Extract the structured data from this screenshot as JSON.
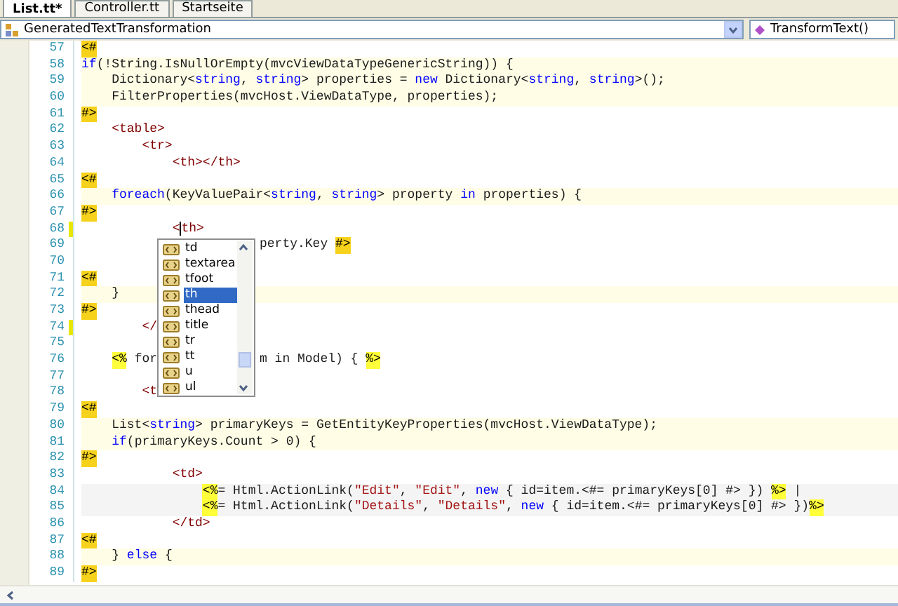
{
  "tabs": [
    {
      "label": "List.tt*",
      "selected": true
    },
    {
      "label": "Controller.tt",
      "selected": false
    },
    {
      "label": "Startseite",
      "selected": false
    }
  ],
  "navigation_bar": {
    "type_combo": "GeneratedTextTransformation",
    "member_combo": "TransformText()"
  },
  "editor": {
    "lines": [
      {
        "number": "57",
        "kind": "text",
        "changed": false,
        "segments": [
          {
            "kind": "marker",
            "text": "<#"
          }
        ]
      },
      {
        "number": "58",
        "kind": "code",
        "changed": false,
        "segments": [
          {
            "kind": "keyword",
            "text": "if"
          },
          {
            "kind": "plain",
            "text": "(!String.IsNullOrEmpty(mvcViewDataTypeGenericString)) {"
          }
        ]
      },
      {
        "number": "59",
        "kind": "code",
        "changed": false,
        "segments": [
          {
            "kind": "plain",
            "text": "    Dictionary<"
          },
          {
            "kind": "keyword",
            "text": "string"
          },
          {
            "kind": "plain",
            "text": ", "
          },
          {
            "kind": "keyword",
            "text": "string"
          },
          {
            "kind": "plain",
            "text": "> properties = "
          },
          {
            "kind": "keyword",
            "text": "new"
          },
          {
            "kind": "plain",
            "text": " Dictionary<"
          },
          {
            "kind": "keyword",
            "text": "string"
          },
          {
            "kind": "plain",
            "text": ", "
          },
          {
            "kind": "keyword",
            "text": "string"
          },
          {
            "kind": "plain",
            "text": ">();"
          }
        ]
      },
      {
        "number": "60",
        "kind": "code",
        "changed": false,
        "segments": [
          {
            "kind": "plain",
            "text": "    FilterProperties(mvcHost.ViewDataType, properties);"
          }
        ]
      },
      {
        "number": "61",
        "kind": "text",
        "changed": false,
        "segments": [
          {
            "kind": "marker",
            "text": "#>"
          }
        ]
      },
      {
        "number": "62",
        "kind": "text",
        "changed": false,
        "segments": [
          {
            "kind": "tag",
            "text": "    <table>"
          }
        ]
      },
      {
        "number": "63",
        "kind": "text",
        "changed": false,
        "segments": [
          {
            "kind": "tag",
            "text": "        <tr>"
          }
        ]
      },
      {
        "number": "64",
        "kind": "text",
        "changed": false,
        "segments": [
          {
            "kind": "tag",
            "text": "            <th></th>"
          }
        ]
      },
      {
        "number": "65",
        "kind": "text",
        "changed": false,
        "segments": [
          {
            "kind": "marker",
            "text": "<#"
          }
        ]
      },
      {
        "number": "66",
        "kind": "code",
        "changed": false,
        "segments": [
          {
            "kind": "keyword",
            "text": "    foreach"
          },
          {
            "kind": "plain",
            "text": "(KeyValuePair<"
          },
          {
            "kind": "keyword",
            "text": "string"
          },
          {
            "kind": "plain",
            "text": ", "
          },
          {
            "kind": "keyword",
            "text": "string"
          },
          {
            "kind": "plain",
            "text": "> property "
          },
          {
            "kind": "keyword",
            "text": "in"
          },
          {
            "kind": "plain",
            "text": " properties) {"
          }
        ]
      },
      {
        "number": "67",
        "kind": "text",
        "changed": false,
        "segments": [
          {
            "kind": "marker",
            "text": "#>"
          }
        ]
      },
      {
        "number": "68",
        "kind": "text",
        "changed": true,
        "cursor": true,
        "segments": [
          {
            "kind": "tag",
            "text": "            <"
          },
          {
            "kind": "tag",
            "text": "th>"
          }
        ]
      },
      {
        "number": "69",
        "kind": "text",
        "changed": false,
        "tail": [
          {
            "kind": "plain",
            "text": "perty.Key "
          },
          {
            "kind": "marker",
            "text": "#>"
          }
        ]
      },
      {
        "number": "70",
        "kind": "text",
        "changed": false
      },
      {
        "number": "71",
        "kind": "text",
        "changed": false,
        "segments": [
          {
            "kind": "marker",
            "text": "<#"
          }
        ]
      },
      {
        "number": "72",
        "kind": "code",
        "changed": false,
        "segments": [
          {
            "kind": "plain",
            "text": "    }"
          }
        ]
      },
      {
        "number": "73",
        "kind": "text",
        "changed": false,
        "segments": [
          {
            "kind": "marker",
            "text": "#>"
          }
        ]
      },
      {
        "number": "74",
        "kind": "text",
        "changed": true,
        "segments": [
          {
            "kind": "tag",
            "text": "        </"
          }
        ]
      },
      {
        "number": "75",
        "kind": "text",
        "changed": false
      },
      {
        "number": "76",
        "kind": "text",
        "changed": false,
        "segments": [
          {
            "kind": "asp",
            "text": "    <%"
          },
          {
            "kind": "plain",
            "text": " for"
          }
        ],
        "tail": [
          {
            "kind": "plain",
            "text": "m in Model) { "
          },
          {
            "kind": "asp",
            "text": "%>"
          }
        ]
      },
      {
        "number": "77",
        "kind": "text",
        "changed": false
      },
      {
        "number": "78",
        "kind": "text",
        "changed": false,
        "segments": [
          {
            "kind": "tag",
            "text": "        <t"
          }
        ]
      },
      {
        "number": "79",
        "kind": "text",
        "changed": false,
        "segments": [
          {
            "kind": "marker",
            "text": "<#"
          }
        ]
      },
      {
        "number": "80",
        "kind": "code",
        "changed": false,
        "segments": [
          {
            "kind": "plain",
            "text": "    List<"
          },
          {
            "kind": "keyword",
            "text": "string"
          },
          {
            "kind": "plain",
            "text": "> primaryKeys = GetEntityKeyProperties(mvcHost.ViewDataType);"
          }
        ]
      },
      {
        "number": "81",
        "kind": "code",
        "changed": false,
        "segments": [
          {
            "kind": "keyword",
            "text": "    if"
          },
          {
            "kind": "plain",
            "text": "(primaryKeys.Count > 0) {"
          }
        ]
      },
      {
        "number": "82",
        "kind": "text",
        "changed": false,
        "segments": [
          {
            "kind": "marker",
            "text": "#>"
          }
        ]
      },
      {
        "number": "83",
        "kind": "text",
        "changed": false,
        "segments": [
          {
            "kind": "tag",
            "text": "            <td>"
          }
        ]
      },
      {
        "number": "84",
        "kind": "server",
        "changed": false,
        "segments": [
          {
            "kind": "asp",
            "text": "                <%"
          },
          {
            "kind": "plain",
            "text": "= Html.ActionLink("
          },
          {
            "kind": "string",
            "text": "\"Edit\""
          },
          {
            "kind": "plain",
            "text": ", "
          },
          {
            "kind": "string",
            "text": "\"Edit\""
          },
          {
            "kind": "plain",
            "text": ", "
          },
          {
            "kind": "keyword",
            "text": "new"
          },
          {
            "kind": "plain",
            "text": " { id=item.<#= primaryKeys[0] #> }) "
          },
          {
            "kind": "asp",
            "text": "%>"
          },
          {
            "kind": "plain",
            "text": " |"
          }
        ]
      },
      {
        "number": "85",
        "kind": "server",
        "changed": false,
        "segments": [
          {
            "kind": "asp",
            "text": "                <%"
          },
          {
            "kind": "plain",
            "text": "= Html.ActionLink("
          },
          {
            "kind": "string",
            "text": "\"Details\""
          },
          {
            "kind": "plain",
            "text": ", "
          },
          {
            "kind": "string",
            "text": "\"Details\""
          },
          {
            "kind": "plain",
            "text": ", "
          },
          {
            "kind": "keyword",
            "text": "new"
          },
          {
            "kind": "plain",
            "text": " { id=item.<#= primaryKeys[0] #> })"
          },
          {
            "kind": "asp",
            "text": "%>"
          }
        ]
      },
      {
        "number": "86",
        "kind": "text",
        "changed": false,
        "segments": [
          {
            "kind": "tag",
            "text": "            </td>"
          }
        ]
      },
      {
        "number": "87",
        "kind": "text",
        "changed": false,
        "segments": [
          {
            "kind": "marker",
            "text": "<#"
          }
        ]
      },
      {
        "number": "88",
        "kind": "code",
        "changed": false,
        "segments": [
          {
            "kind": "plain",
            "text": "    } "
          },
          {
            "kind": "keyword",
            "text": "else"
          },
          {
            "kind": "plain",
            "text": " {"
          }
        ]
      },
      {
        "number": "89",
        "kind": "text",
        "changed": false,
        "segments": [
          {
            "kind": "marker",
            "text": "#>"
          }
        ]
      }
    ]
  },
  "completion_list": {
    "items": [
      {
        "label": "td",
        "selected": false
      },
      {
        "label": "textarea",
        "selected": false
      },
      {
        "label": "tfoot",
        "selected": false
      },
      {
        "label": "th",
        "selected": true
      },
      {
        "label": "thead",
        "selected": false
      },
      {
        "label": "title",
        "selected": false
      },
      {
        "label": "tr",
        "selected": false
      },
      {
        "label": "tt",
        "selected": false
      },
      {
        "label": "u",
        "selected": false
      },
      {
        "label": "ul",
        "selected": false
      }
    ]
  }
}
